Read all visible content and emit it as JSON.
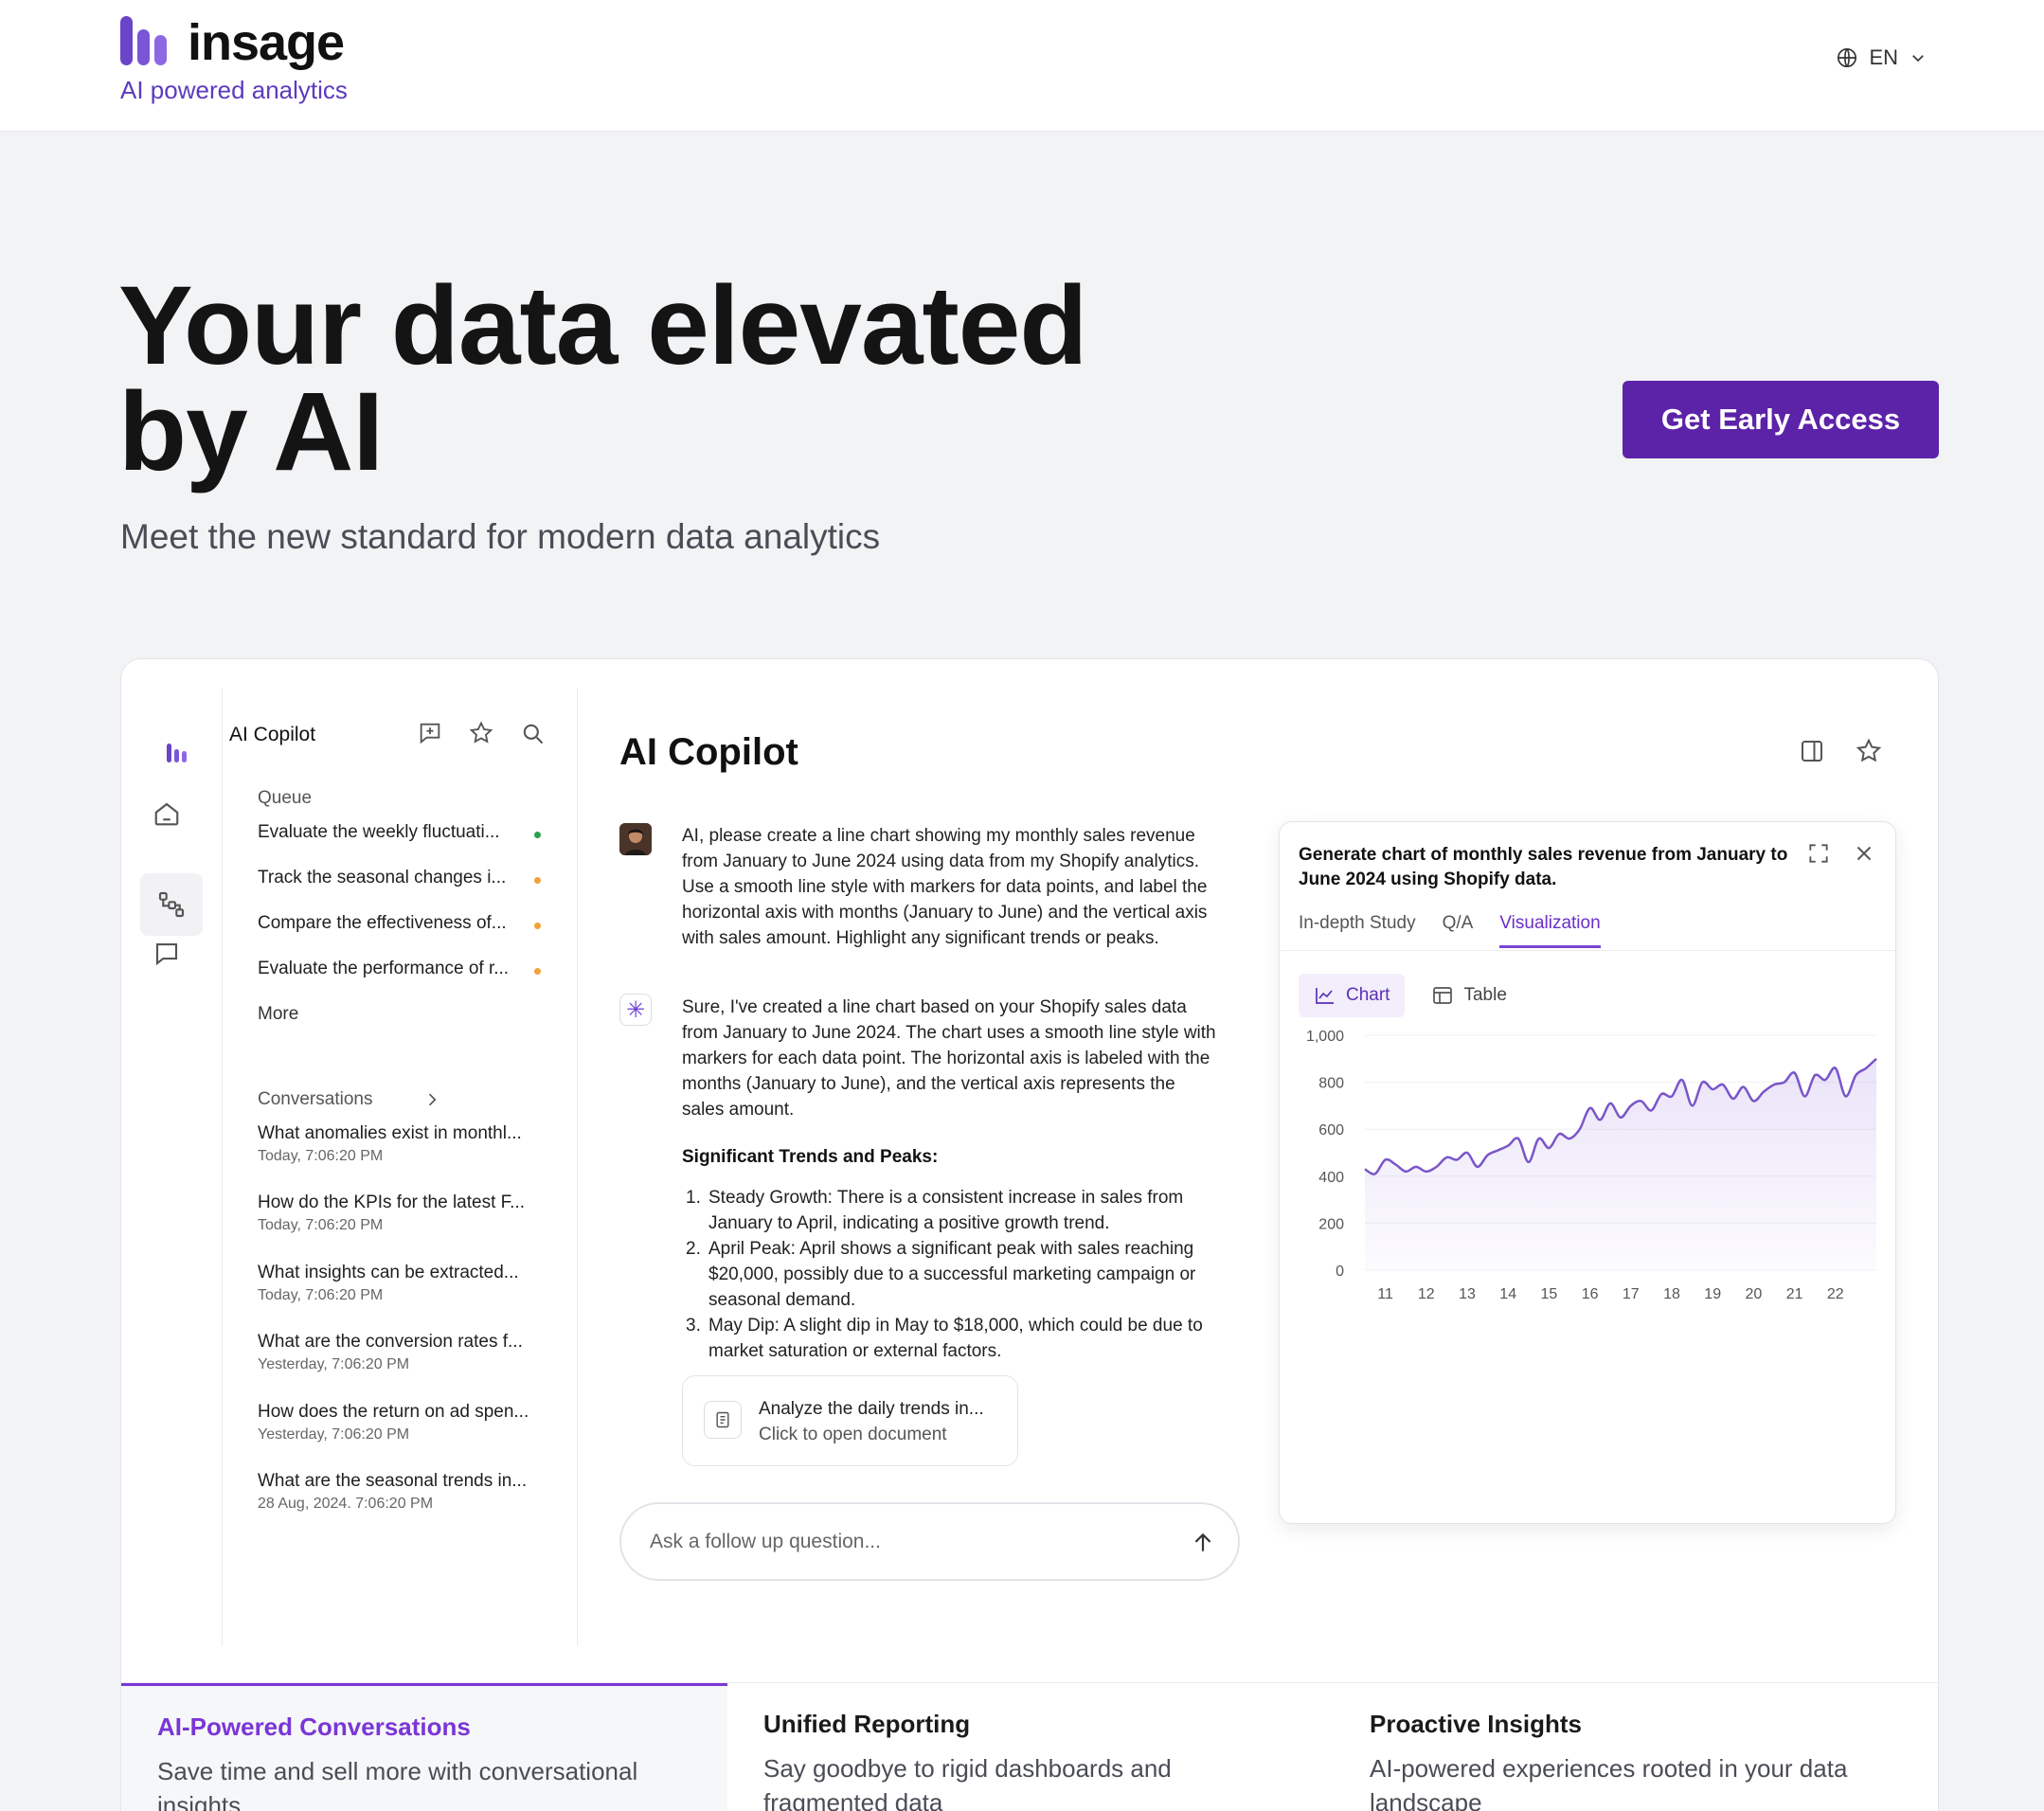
{
  "header": {
    "brand": "insage",
    "tagline": "AI powered analytics",
    "language": "EN"
  },
  "hero": {
    "title_line1": "Your data elevated",
    "title_line2": "by AI",
    "subtitle": "Meet the new standard for modern data analytics",
    "cta": "Get Early Access"
  },
  "app": {
    "panel_title": "AI Copilot",
    "queue_label": "Queue",
    "queue": [
      {
        "label": "Evaluate the weekly fluctuati...",
        "status_color": "#2e9e4f"
      },
      {
        "label": "Track the seasonal changes i...",
        "status_color": "#f0a23a"
      },
      {
        "label": "Compare the effectiveness of...",
        "status_color": "#f0a23a"
      },
      {
        "label": "Evaluate the performance of r...",
        "status_color": "#f0a23a"
      }
    ],
    "more_label": "More",
    "conversations_label": "Conversations",
    "conversations": [
      {
        "title": "What anomalies exist in monthl...",
        "time": "Today, 7:06:20 PM"
      },
      {
        "title": "How do the KPIs for the latest F...",
        "time": "Today, 7:06:20 PM"
      },
      {
        "title": "What insights can be extracted...",
        "time": "Today, 7:06:20 PM"
      },
      {
        "title": "What are the conversion rates f...",
        "time": "Yesterday, 7:06:20 PM"
      },
      {
        "title": "How does the return on ad spen...",
        "time": "Yesterday, 7:06:20 PM"
      },
      {
        "title": "What are the seasonal trends in...",
        "time": "28 Aug, 2024. 7:06:20 PM"
      }
    ],
    "main_title": "AI Copilot",
    "user_message": "AI, please create a line chart showing my monthly sales revenue from January to June 2024 using data from my Shopify analytics. Use a smooth line style with markers for data points, and label the horizontal axis with months (January to June) and the vertical axis with sales amount. Highlight any significant trends or peaks.",
    "bot_message": "Sure, I've created a line chart based on your Shopify sales data from January to June 2024. The chart uses a smooth line style with markers for each data point. The horizontal axis is labeled with the months (January to June), and the vertical axis represents the sales amount.",
    "trends_heading": "Significant Trends and Peaks:",
    "trends": [
      {
        "n": "1.",
        "text": "Steady Growth: There is a consistent increase in sales from January to April, indicating a positive growth trend."
      },
      {
        "n": "2.",
        "text": "April Peak: April shows a significant peak with sales reaching $20,000, possibly due to a successful marketing campaign or seasonal demand."
      },
      {
        "n": "3.",
        "text": "May Dip: A slight dip in May to $18,000, which could be due to market saturation or external factors."
      }
    ],
    "doc_chip": {
      "title": "Analyze the daily trends in...",
      "subtitle": "Click to open document"
    },
    "ask_placeholder": "Ask a follow up question...",
    "chart_card": {
      "title": "Generate chart of monthly sales revenue from January to June 2024 using Shopify data.",
      "tabs": [
        "In-depth Study",
        "Q/A",
        "Visualization"
      ],
      "active_tab": "Visualization",
      "view_chart": "Chart",
      "view_table": "Table"
    }
  },
  "features": [
    {
      "title": "AI-Powered Conversations",
      "text": "Save time and sell more with conversational insights"
    },
    {
      "title": "Unified Reporting",
      "text": "Say goodbye to rigid dashboards and fragmented data"
    },
    {
      "title": "Proactive Insights",
      "text": "AI-powered experiences rooted in your data landscape"
    }
  ],
  "colors": {
    "brand": "#5c22a8",
    "accent": "#7a36d6",
    "line": "#7a55c9"
  },
  "chart_data": {
    "type": "area",
    "x": [
      10.5,
      10.75,
      11.0,
      11.25,
      11.5,
      11.75,
      12.0,
      12.25,
      12.5,
      12.75,
      13.0,
      13.25,
      13.5,
      13.75,
      14.0,
      14.25,
      14.5,
      14.75,
      15.0,
      15.25,
      15.5,
      15.75,
      16.0,
      16.25,
      16.5,
      16.75,
      17.0,
      17.25,
      17.5,
      17.75,
      18.0,
      18.25,
      18.5,
      18.75,
      19.0,
      19.25,
      19.5,
      19.75,
      20.0,
      20.25,
      20.5,
      20.75,
      21.0,
      21.25,
      21.5,
      21.75,
      22.0,
      22.25,
      22.5,
      22.75,
      23.0
    ],
    "values": [
      430,
      410,
      470,
      450,
      420,
      440,
      420,
      440,
      480,
      470,
      500,
      440,
      490,
      510,
      530,
      560,
      460,
      560,
      520,
      580,
      560,
      600,
      690,
      640,
      710,
      650,
      700,
      720,
      680,
      750,
      740,
      810,
      700,
      800,
      770,
      790,
      730,
      780,
      720,
      760,
      790,
      800,
      840,
      740,
      830,
      810,
      860,
      740,
      830,
      860,
      900
    ],
    "title": "",
    "xlabel": "",
    "ylabel": "",
    "xticks": [
      "11",
      "12",
      "13",
      "14",
      "15",
      "16",
      "17",
      "18",
      "19",
      "20",
      "21",
      "22"
    ],
    "yticks": [
      "0",
      "200",
      "400",
      "600",
      "800",
      "1,000"
    ],
    "ylim": [
      0,
      1000
    ],
    "xlim": [
      10.5,
      23
    ],
    "grid": true
  }
}
